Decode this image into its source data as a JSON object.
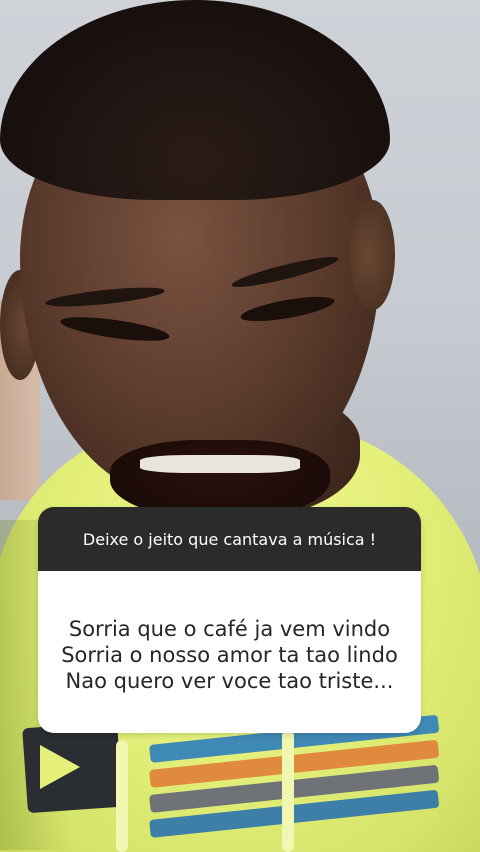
{
  "story": {
    "question_sticker": {
      "question": "Deixe o jeito que cantava a música !",
      "answer_lines": [
        "Sorria que o café ja vem vindo",
        "Sorria o nosso amor ta tao lindo",
        "Nao quero ver voce tao triste..."
      ],
      "header_color": "#2b2b2b",
      "body_color": "#ffffff"
    },
    "background": {
      "description_icon": "person-photo",
      "shirt_color": "#e4f07a"
    }
  }
}
